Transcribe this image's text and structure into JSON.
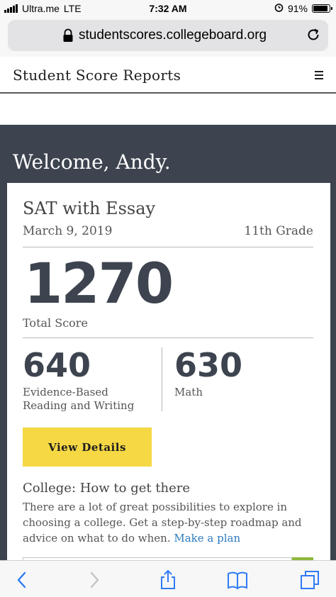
{
  "status_bar": {
    "carrier": "Ultra.me",
    "network": "LTE",
    "time": "7:32 AM",
    "battery_percent": "91%",
    "battery_level": 0.91
  },
  "browser": {
    "url": "studentscores.collegeboard.org",
    "icons": [
      "lock-icon",
      "reload-icon"
    ]
  },
  "site": {
    "title": "Student Score Reports",
    "menu_icon": "hamburger-menu-icon"
  },
  "welcome": "Welcome, Andy.",
  "score_card": {
    "test_name": "SAT with Essay",
    "date": "March 9, 2019",
    "grade": "11th Grade",
    "total_score": "1270",
    "total_label": "Total Score",
    "sections": [
      {
        "score": "640",
        "label_line1": "Evidence-Based",
        "label_line2": "Reading and Writing"
      },
      {
        "score": "630",
        "label_line1": "Math"
      }
    ],
    "view_details_label": "View Details"
  },
  "college": {
    "heading": "College: How to get there",
    "body": "There are a lot of great possibilities to explore in choosing a college. Get a step-by-step roadmap and advice on what to do when.",
    "link_label": "Make a plan"
  },
  "toolbar": {
    "icons": [
      "back-icon",
      "forward-icon",
      "share-icon",
      "bookmarks-icon",
      "tabs-icon"
    ]
  },
  "colors": {
    "dark_band": "#3d444f",
    "button_yellow": "#f5d844",
    "link_blue": "#2c7bbf"
  }
}
